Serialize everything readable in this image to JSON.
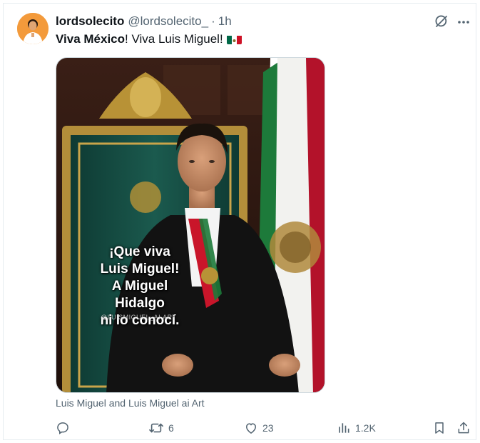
{
  "tweet": {
    "display_name": "lordsolecito",
    "handle": "@lordsolecito_",
    "separator": "·",
    "timestamp": "1h",
    "text_bold": "Viva México",
    "text_rest": "!  Viva Luis Miguel!",
    "flag_emoji_colors": [
      "#006847",
      "#ffffff",
      "#ce1126"
    ]
  },
  "media": {
    "overlay_line_1": "¡Que viva",
    "overlay_line_2": "Luis Miguel!",
    "overlay_line_3": "A Miguel Hidalgo",
    "overlay_line_4": "ni lo conocí.",
    "watermark": "@LUISMIGUEL_AI.ART",
    "caption": "Luis Miguel and Luis Miguel ai Art"
  },
  "actions": {
    "reply_count": "",
    "retweet_count": "6",
    "like_count": "23",
    "views_count": "1.2K"
  },
  "colors": {
    "text_primary": "#0f1419",
    "text_secondary": "#536471",
    "border": "#cfd9de"
  },
  "icons": [
    "grok-icon",
    "more-icon",
    "reply-icon",
    "retweet-icon",
    "like-icon",
    "views-icon",
    "bookmark-icon",
    "share-icon"
  ]
}
